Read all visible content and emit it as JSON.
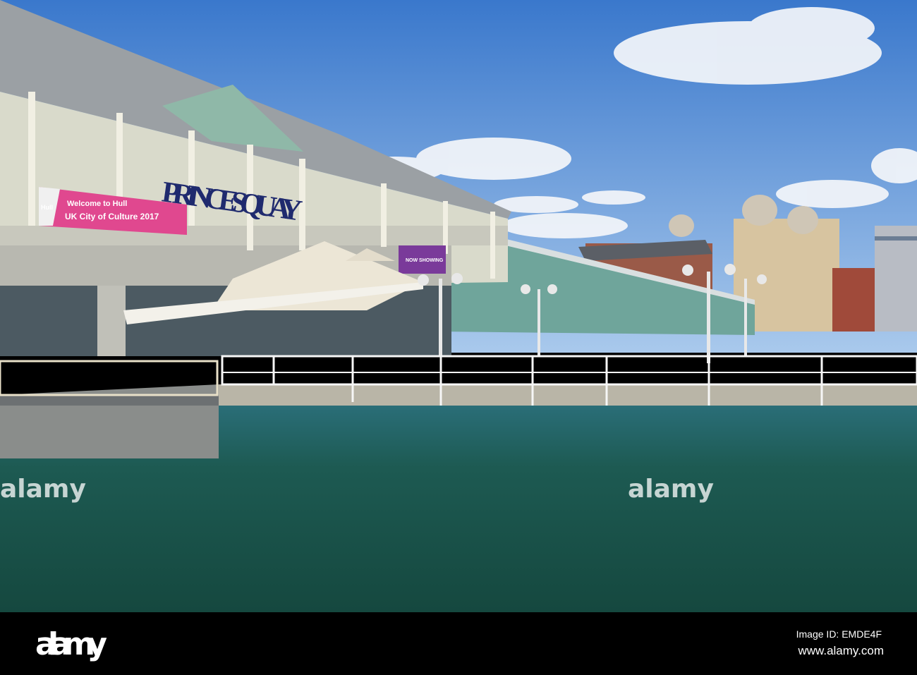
{
  "building_sign": {
    "line": "PRINCES QUAY"
  },
  "banner": {
    "logo": "Hull",
    "line1": "Welcome to Hull",
    "line2": "UK City of Culture 2017"
  },
  "purple_banner": {
    "text": "NOW SHOWING"
  },
  "watermark": {
    "left": "alamy",
    "right": "alamy"
  },
  "footer": {
    "logo": "alamy",
    "image_id": "Image ID: EMDE4F",
    "url": "www.alamy.com"
  },
  "colors": {
    "sky_top": "#3a78cc",
    "sky_bottom": "#a9c9ec",
    "water": "#1d5a52",
    "banner_pink": "#e0488f",
    "banner_purple": "#7a3a9a",
    "sign_navy": "#1f2a6e"
  }
}
